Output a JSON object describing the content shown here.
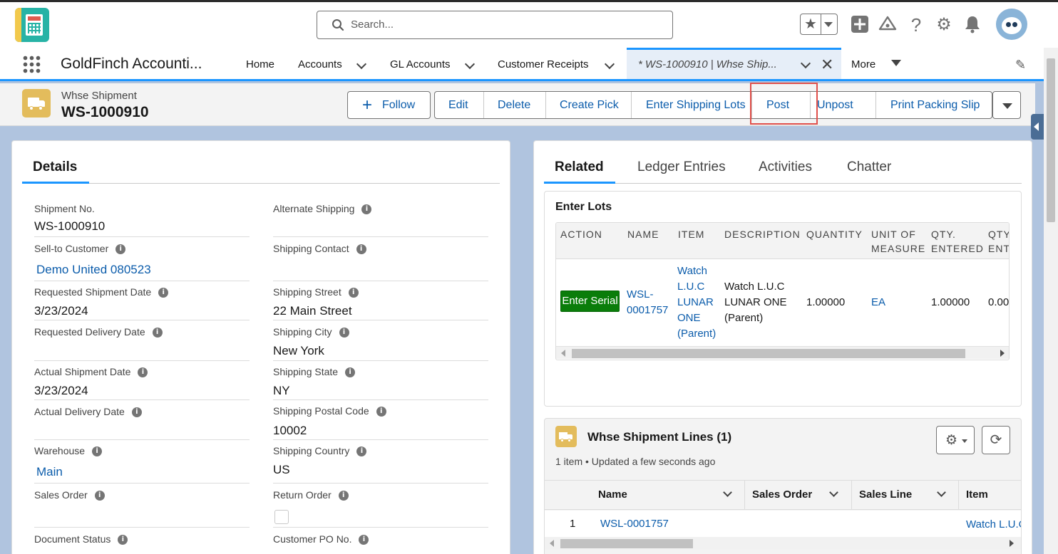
{
  "global_header": {
    "search_placeholder": "Search...",
    "icons": [
      "favorites-star-icon",
      "add-icon",
      "trailhead-icon",
      "help-icon",
      "setup-gear-icon",
      "notifications-bell-icon",
      "avatar"
    ]
  },
  "navbar": {
    "app_name": "GoldFinch Accounti...",
    "items": [
      {
        "label": "Home"
      },
      {
        "label": "Accounts"
      },
      {
        "label": "GL Accounts"
      },
      {
        "label": "Customer Receipts"
      }
    ],
    "active_tab": "* WS-1000910 | Whse Ship...",
    "more_label": "More"
  },
  "record": {
    "type": "Whse Shipment",
    "name": "WS-1000910",
    "follow_label": "Follow",
    "actions": [
      "Edit",
      "Delete",
      "Create Pick",
      "Enter Shipping Lots",
      "Post",
      "Unpost",
      "Print Packing Slip"
    ]
  },
  "details": {
    "tab_label": "Details",
    "left": [
      {
        "label": "Shipment No.",
        "value": "WS-1000910",
        "link": false,
        "info": false
      },
      {
        "label": "Sell-to Customer",
        "value": "Demo United 080523",
        "link": true,
        "info": true
      },
      {
        "label": "Requested Shipment Date",
        "value": "3/23/2024",
        "link": false,
        "info": true
      },
      {
        "label": "Requested Delivery Date",
        "value": "",
        "link": false,
        "info": true
      },
      {
        "label": "Actual Shipment Date",
        "value": "3/23/2024",
        "link": false,
        "info": true
      },
      {
        "label": "Actual Delivery Date",
        "value": "",
        "link": false,
        "info": true
      },
      {
        "label": "Warehouse",
        "value": "Main",
        "link": true,
        "info": true
      },
      {
        "label": "Sales Order",
        "value": "",
        "link": false,
        "info": true
      },
      {
        "label": "Document Status",
        "value": "",
        "link": false,
        "info": true
      }
    ],
    "right": [
      {
        "label": "Alternate Shipping",
        "value": "",
        "info": true
      },
      {
        "label": "Shipping Contact",
        "value": "",
        "info": true
      },
      {
        "label": "Shipping Street",
        "value": "22 Main Street",
        "info": true
      },
      {
        "label": "Shipping City",
        "value": "New York",
        "info": true
      },
      {
        "label": "Shipping State",
        "value": "NY",
        "info": true
      },
      {
        "label": "Shipping Postal Code",
        "value": "10002",
        "info": true
      },
      {
        "label": "Shipping Country",
        "value": "US",
        "info": true
      },
      {
        "label": "Return Order",
        "value": "",
        "info": true,
        "checkbox": true
      },
      {
        "label": "Customer PO No.",
        "value": "",
        "info": true
      }
    ]
  },
  "related": {
    "tabs": [
      "Related",
      "Ledger Entries",
      "Activities",
      "Chatter"
    ],
    "active_tab": "Related",
    "enter_lots": {
      "title": "Enter Lots",
      "columns": [
        "ACTION",
        "NAME",
        "ITEM",
        "DESCRIPTION",
        "QUANTITY",
        "UNIT OF MEASURE",
        "QTY. ENTERED",
        "QTY. ENT"
      ],
      "row": {
        "action_button": "Enter Serial",
        "name": "WSL-0001757",
        "item": "Watch L.U.C LUNAR ONE (Parent)",
        "description": "Watch L.U.C LUNAR ONE (Parent)",
        "quantity": "1.00000",
        "unit_of_measure": "EA",
        "qty_entered": "1.00000",
        "qty_ent_partial": "0.00"
      }
    },
    "shipment_lines": {
      "title": "Whse Shipment Lines (1)",
      "subtitle": "1 item • Updated a few seconds ago",
      "columns": [
        "Name",
        "Sales Order",
        "Sales Line",
        "Item"
      ],
      "rows": [
        {
          "num": "1",
          "name": "WSL-0001757",
          "sales_order": "",
          "sales_line": "",
          "item": "Watch L.U.C"
        }
      ]
    }
  }
}
